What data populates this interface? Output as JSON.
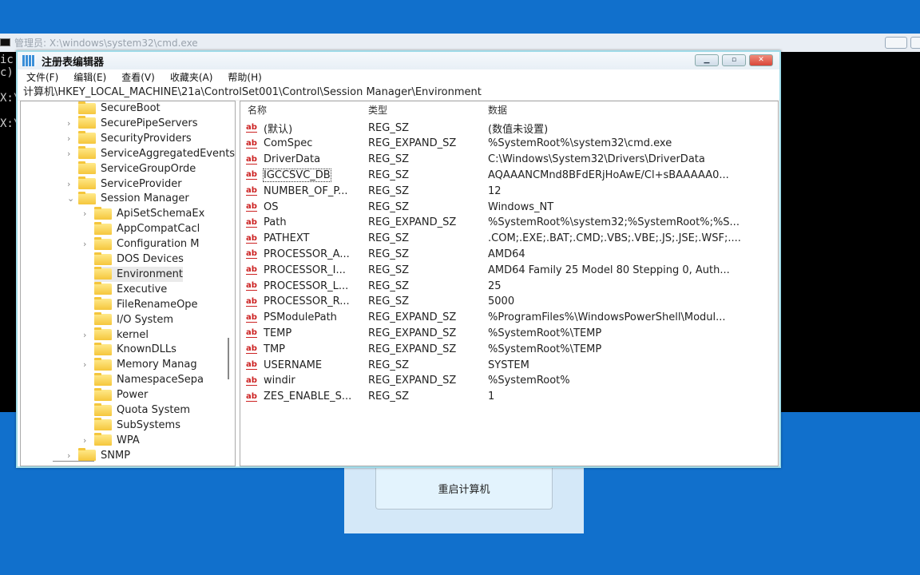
{
  "cmd": {
    "title": "管理员: X:\\windows\\system32\\cmd.exe",
    "lines": [
      "ic",
      "c)",
      "",
      "X:\\",
      "",
      "X:\\"
    ]
  },
  "dialog": {
    "restart_label": "重启计算机"
  },
  "regedit": {
    "title": "注册表编辑器",
    "menu": [
      "文件(F)",
      "编辑(E)",
      "查看(V)",
      "收藏夹(A)",
      "帮助(H)"
    ],
    "address": "计算机\\HKEY_LOCAL_MACHINE\\21a\\ControlSet001\\Control\\Session Manager\\Environment",
    "tree": [
      {
        "label": "SecureBoot",
        "level": 1,
        "chevron": ""
      },
      {
        "label": "SecurePipeServers",
        "level": 1,
        "chevron": ">"
      },
      {
        "label": "SecurityProviders",
        "level": 1,
        "chevron": ">"
      },
      {
        "label": "ServiceAggregatedEvents",
        "level": 1,
        "chevron": ">"
      },
      {
        "label": "ServiceGroupOrde",
        "level": 1,
        "chevron": ""
      },
      {
        "label": "ServiceProvider",
        "level": 1,
        "chevron": ">"
      },
      {
        "label": "Session Manager",
        "level": 1,
        "chevron": "v"
      },
      {
        "label": "ApiSetSchemaEx",
        "level": 2,
        "chevron": ">"
      },
      {
        "label": "AppCompatCacl",
        "level": 2,
        "chevron": ""
      },
      {
        "label": "Configuration M",
        "level": 2,
        "chevron": ">"
      },
      {
        "label": "DOS Devices",
        "level": 2,
        "chevron": ""
      },
      {
        "label": "Environment",
        "level": 2,
        "chevron": "",
        "selected": true
      },
      {
        "label": "Executive",
        "level": 2,
        "chevron": ""
      },
      {
        "label": "FileRenameOpe",
        "level": 2,
        "chevron": ""
      },
      {
        "label": "I/O System",
        "level": 2,
        "chevron": ""
      },
      {
        "label": "kernel",
        "level": 2,
        "chevron": ">"
      },
      {
        "label": "KnownDLLs",
        "level": 2,
        "chevron": ""
      },
      {
        "label": "Memory Manag",
        "level": 2,
        "chevron": ">"
      },
      {
        "label": "NamespaceSepa",
        "level": 2,
        "chevron": ""
      },
      {
        "label": "Power",
        "level": 2,
        "chevron": ""
      },
      {
        "label": "Quota System",
        "level": 2,
        "chevron": ""
      },
      {
        "label": "SubSystems",
        "level": 2,
        "chevron": ""
      },
      {
        "label": "WPA",
        "level": 2,
        "chevron": ">"
      },
      {
        "label": "SNMP",
        "level": 1,
        "chevron": ">"
      }
    ],
    "columns": {
      "name": "名称",
      "type": "类型",
      "data": "数据"
    },
    "values": [
      {
        "name": "(默认)",
        "type": "REG_SZ",
        "data": "(数值未设置)"
      },
      {
        "name": "ComSpec",
        "type": "REG_EXPAND_SZ",
        "data": "%SystemRoot%\\system32\\cmd.exe"
      },
      {
        "name": "DriverData",
        "type": "REG_SZ",
        "data": "C:\\Windows\\System32\\Drivers\\DriverData"
      },
      {
        "name": "IGCCSVC_DB",
        "type": "REG_SZ",
        "data": "AQAAANCMnd8BFdERjHoAwE/Cl+sBAAAAA0...",
        "focused": true
      },
      {
        "name": "NUMBER_OF_P...",
        "type": "REG_SZ",
        "data": "12"
      },
      {
        "name": "OS",
        "type": "REG_SZ",
        "data": "Windows_NT"
      },
      {
        "name": "Path",
        "type": "REG_EXPAND_SZ",
        "data": "%SystemRoot%\\system32;%SystemRoot%;%S..."
      },
      {
        "name": "PATHEXT",
        "type": "REG_SZ",
        "data": ".COM;.EXE;.BAT;.CMD;.VBS;.VBE;.JS;.JSE;.WSF;...."
      },
      {
        "name": "PROCESSOR_A...",
        "type": "REG_SZ",
        "data": "AMD64"
      },
      {
        "name": "PROCESSOR_I...",
        "type": "REG_SZ",
        "data": "AMD64 Family 25 Model 80 Stepping 0, Auth..."
      },
      {
        "name": "PROCESSOR_L...",
        "type": "REG_SZ",
        "data": "25"
      },
      {
        "name": "PROCESSOR_R...",
        "type": "REG_SZ",
        "data": "5000"
      },
      {
        "name": "PSModulePath",
        "type": "REG_EXPAND_SZ",
        "data": "%ProgramFiles%\\WindowsPowerShell\\Modul..."
      },
      {
        "name": "TEMP",
        "type": "REG_EXPAND_SZ",
        "data": "%SystemRoot%\\TEMP"
      },
      {
        "name": "TMP",
        "type": "REG_EXPAND_SZ",
        "data": "%SystemRoot%\\TEMP"
      },
      {
        "name": "USERNAME",
        "type": "REG_SZ",
        "data": "SYSTEM"
      },
      {
        "name": "windir",
        "type": "REG_EXPAND_SZ",
        "data": "%SystemRoot%"
      },
      {
        "name": "ZES_ENABLE_S...",
        "type": "REG_SZ",
        "data": "1"
      }
    ]
  }
}
